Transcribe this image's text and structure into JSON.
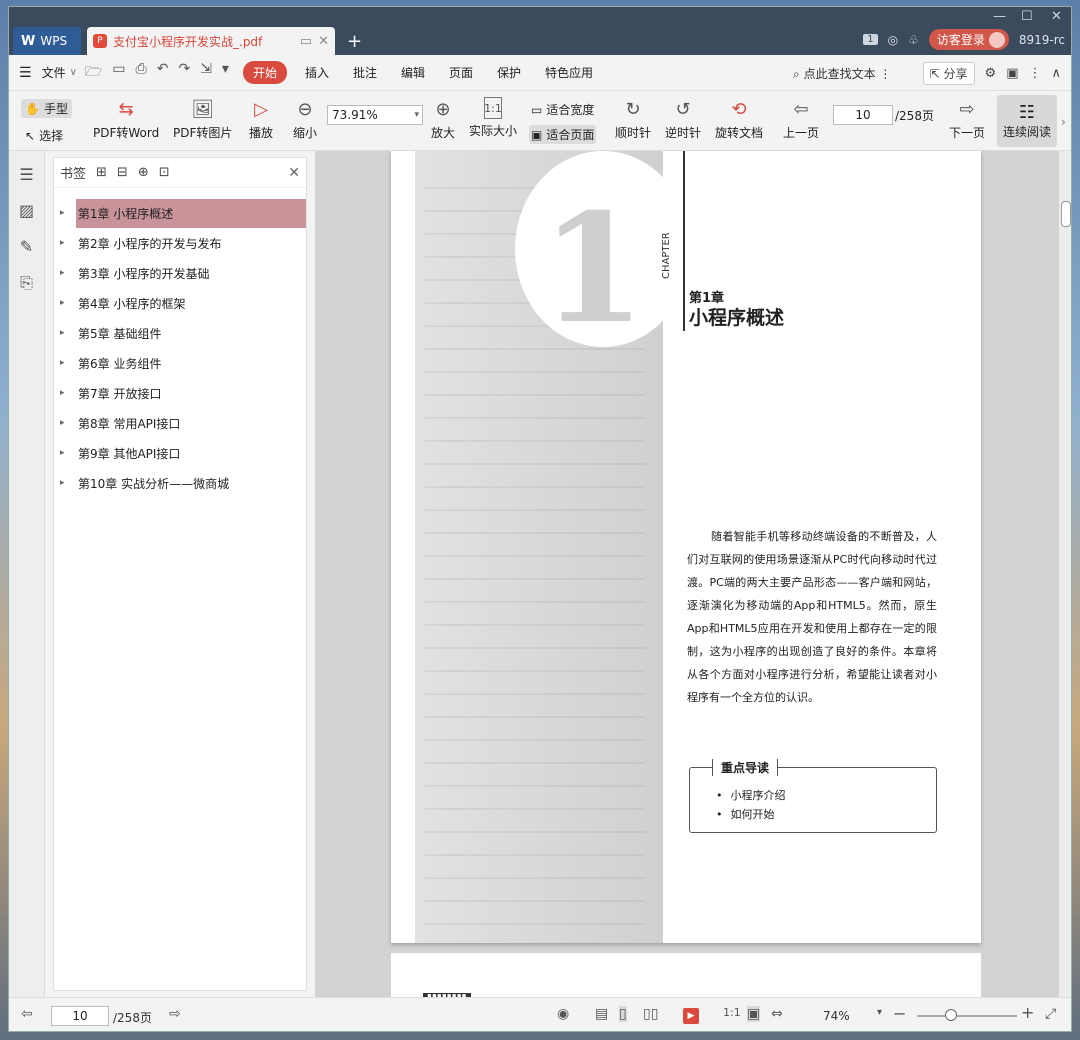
{
  "titlebar": {
    "app_tab": "WPS",
    "doc_tab_title": "支付宝小程序开发实战_.pdf",
    "login_label": "访客登录",
    "user_id": "8919-rc",
    "badge": "1"
  },
  "menubar": {
    "file_label": "文件",
    "items": [
      "开始",
      "插入",
      "批注",
      "编辑",
      "页面",
      "保护",
      "特色应用"
    ],
    "search_text": "点此查找文本",
    "share_label": "分享"
  },
  "toolbar": {
    "hand_label": "手型",
    "select_label": "选择",
    "pdf_to_word": "PDF转Word",
    "pdf_to_image": "PDF转图片",
    "play": "播放",
    "zoom_out": "缩小",
    "zoom_value": "73.91%",
    "zoom_in": "放大",
    "actual_size": "实际大小",
    "fit_width": "适合宽度",
    "fit_page": "适合页面",
    "clockwise": "顺时针",
    "counter_clockwise": "逆时针",
    "rotate_doc": "旋转文档",
    "prev_page": "上一页",
    "current_page": "10",
    "total_pages": "/258页",
    "next_page": "下一页",
    "continuous_read": "连续阅读"
  },
  "bookmarks": {
    "title": "书签",
    "items": [
      "第1章 小程序概述",
      "第2章 小程序的开发与发布",
      "第3章 小程序的开发基础",
      "第4章 小程序的框架",
      "第5章 基础组件",
      "第6章 业务组件",
      "第7章 开放接口",
      "第8章 常用API接口",
      "第9章 其他API接口",
      "第10章 实战分析——微商城"
    ]
  },
  "page": {
    "big_number": "1",
    "chapter_word": "CHAPTER",
    "chapter_num": "第1章",
    "chapter_title": "小程序概述",
    "intro": "随着智能手机等移动终端设备的不断普及，人们对互联网的使用场景逐渐从PC时代向移动时代过渡。PC端的两大主要产品形态——客户端和网站，逐渐演化为移动端的App和HTML5。然而，原生App和HTML5应用在开发和使用上都存在一定的限制，这为小程序的出现创造了良好的条件。本章将从各个方面对小程序进行分析，希望能让读者对小程序有一个全方位的认识。",
    "focus_title": "重点导读",
    "focus_items": [
      "小程序介绍",
      "如何开始"
    ]
  },
  "statusbar": {
    "page_value": "10",
    "total_pages": "/258页",
    "zoom_percent": "74%"
  },
  "colors": {
    "accent": "#d94a3f",
    "titlebar": "#3c4a5e",
    "selected_bookmark": "#c9939a"
  }
}
